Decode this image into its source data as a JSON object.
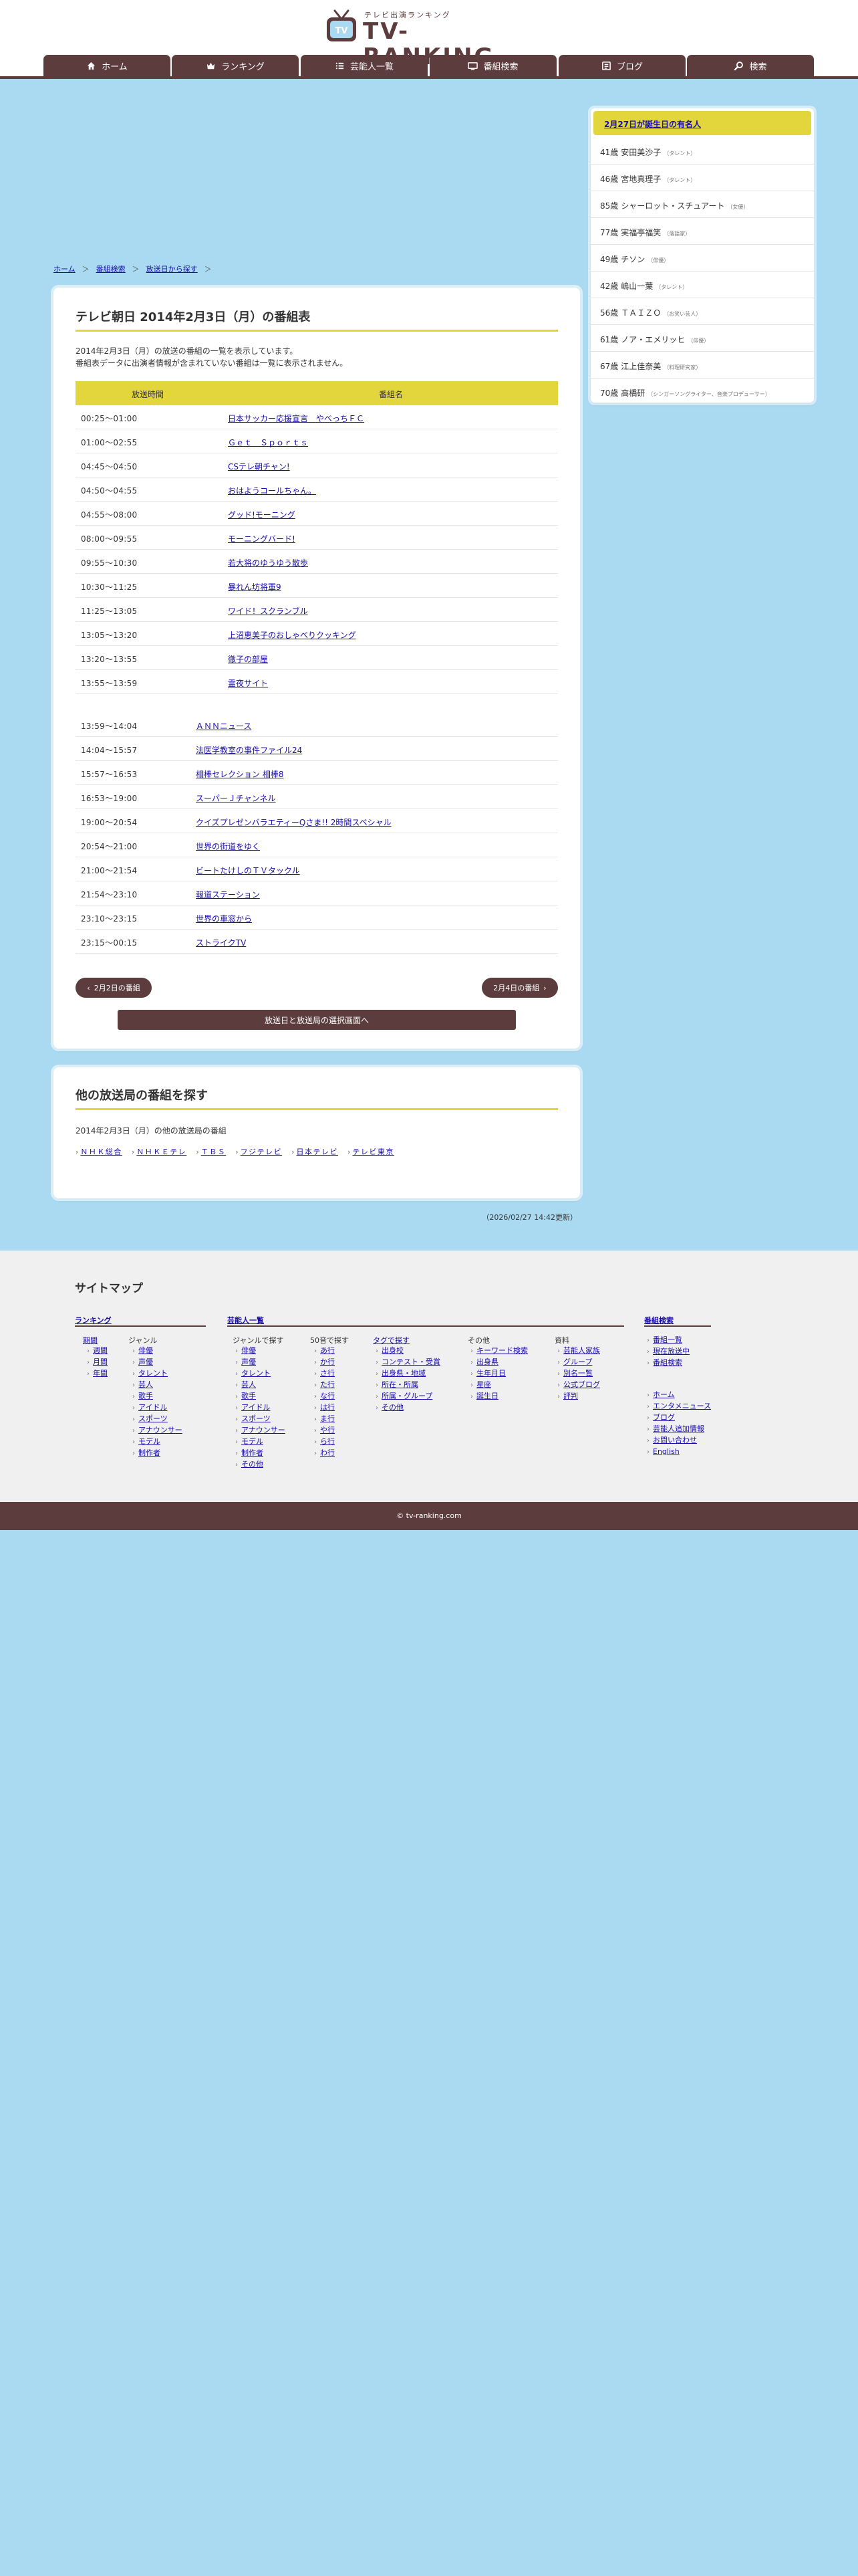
{
  "header": {
    "tagline": "テレビ出演ランキング",
    "logo_text": "TV-RANKING",
    "logo_badge": "TV",
    "nav": [
      {
        "label": "ホーム",
        "icon": "home-icon"
      },
      {
        "label": "ランキング",
        "icon": "crown-icon"
      },
      {
        "label": "芸能人一覧",
        "icon": "list-icon"
      },
      {
        "label": "番組検索",
        "icon": "tv-icon"
      },
      {
        "label": "ブログ",
        "icon": "blog-icon"
      },
      {
        "label": "検索",
        "icon": "search-icon"
      }
    ]
  },
  "breadcrumb": {
    "items": [
      "ホーム",
      "番組検索",
      "放送日から探す"
    ],
    "separator": "＞"
  },
  "schedule": {
    "title": "テレビ朝日 2014年2月3日（月）の番組表",
    "desc_line1": "2014年2月3日（月）の放送の番組の一覧を表示しています。",
    "desc_line2": "番組表データに出演者情報が含まれていない番組は一覧に表示されません。",
    "col_time": "放送時間",
    "col_program": "番組名",
    "rows": [
      {
        "time": "00:25〜01:00",
        "program": "日本サッカー応援宣言　やべっちＦＣ"
      },
      {
        "time": "01:00〜02:55",
        "program": "Ｇｅｔ　Ｓｐｏｒｔｓ"
      },
      {
        "time": "04:45〜04:50",
        "program": "CSテレ朝チャン!"
      },
      {
        "time": "04:50〜04:55",
        "program": "おはようコールちゃん。"
      },
      {
        "time": "04:55〜08:00",
        "program": "グッド!モーニング"
      },
      {
        "time": "08:00〜09:55",
        "program": "モーニングバード!"
      },
      {
        "time": "09:55〜10:30",
        "program": "若大将のゆうゆう散歩"
      },
      {
        "time": "10:30〜11:25",
        "program": "暴れん坊将軍9"
      },
      {
        "time": "11:25〜13:05",
        "program": "ワイド！スクランブル"
      },
      {
        "time": "13:05〜13:20",
        "program": "上沼恵美子のおしゃべりクッキング"
      },
      {
        "time": "13:20〜13:55",
        "program": "徹子の部屋"
      },
      {
        "time": "13:55〜13:59",
        "program": "霊夜サイト"
      }
    ],
    "rows2": [
      {
        "time": "13:59〜14:04",
        "program": "ＡＮＮニュース"
      },
      {
        "time": "14:04〜15:57",
        "program": "法医学教室の事件ファイル24"
      },
      {
        "time": "15:57〜16:53",
        "program": "相棒セレクション 相棒8"
      },
      {
        "time": "16:53〜19:00",
        "program": "スーパーＪチャンネル"
      },
      {
        "time": "19:00〜20:54",
        "program": "クイズプレゼンバラエティーQさま!! 2時間スペシャル"
      },
      {
        "time": "20:54〜21:00",
        "program": "世界の街道をゆく"
      },
      {
        "time": "21:00〜21:54",
        "program": "ビートたけしのＴＶタックル"
      },
      {
        "time": "21:54〜23:10",
        "program": "報道ステーション"
      },
      {
        "time": "23:10〜23:15",
        "program": "世界の車窓から"
      },
      {
        "time": "23:15〜00:15",
        "program": "ストライクTV"
      }
    ],
    "prev_label": "2月2日の番組",
    "next_label": "2月4日の番組",
    "select_label": "放送日と放送局の選択画面へ"
  },
  "other": {
    "title": "他の放送局の番組を探す",
    "subtitle": "2014年2月3日（月）の他の放送局の番組",
    "stations": [
      "ＮＨＫ総合",
      "ＮＨＫＥテレ",
      "ＴＢＳ",
      "フジテレビ",
      "日本テレビ",
      "テレビ東京"
    ]
  },
  "updated": "（2026/02/27 14:42更新）",
  "birthday": {
    "title": "2月27日が誕生日の有名人",
    "people": [
      {
        "age": "41歳",
        "name": "安田美沙子",
        "genre": "（タレント）"
      },
      {
        "age": "46歳",
        "name": "宮地真理子",
        "genre": "（タレント）"
      },
      {
        "age": "85歳",
        "name": "シャーロット・スチュアート",
        "genre": "（女優）"
      },
      {
        "age": "77歳",
        "name": "実福亭福笑",
        "genre": "（落語家）"
      },
      {
        "age": "49歳",
        "name": "チソン",
        "genre": "（俳優）"
      },
      {
        "age": "42歳",
        "name": "嶋山一葉",
        "genre": "（タレント）"
      },
      {
        "age": "56歳",
        "name": "ＴＡＩＺＯ",
        "genre": "（お笑い芸人）"
      },
      {
        "age": "61歳",
        "name": "ノア・エメリッヒ",
        "genre": "（俳優）"
      },
      {
        "age": "67歳",
        "name": "江上佳奈美",
        "genre": "（料理研究家）"
      },
      {
        "age": "70歳",
        "name": "高橋研",
        "genre": "（シンガーソングライター、音楽プロデューサー）"
      }
    ]
  },
  "sitemap": {
    "title": "サイトマップ",
    "ranking": {
      "head": "ランキング",
      "period_label": "期間",
      "periods": [
        "週間",
        "月間",
        "年間"
      ],
      "genre_label": "ジャンル",
      "genres": [
        "俳優",
        "声優",
        "タレント",
        "芸人",
        "歌手",
        "アイドル",
        "スポーツ",
        "アナウンサー",
        "モデル",
        "制作者"
      ]
    },
    "talents": {
      "head": "芸能人一覧",
      "genre_label": "ジャンルで探す",
      "genres": [
        "俳優",
        "声優",
        "タレント",
        "芸人",
        "歌手",
        "アイドル",
        "スポーツ",
        "アナウンサー",
        "モデル",
        "制作者",
        "その他"
      ],
      "kana_label": "50音で探す",
      "kana": [
        "あ行",
        "か行",
        "さ行",
        "た行",
        "な行",
        "は行",
        "ま行",
        "や行",
        "ら行",
        "わ行"
      ],
      "tag_label": "タグで探す",
      "tags": [
        "出身校",
        "コンテスト・受賞",
        "出身県・地域",
        "所在・所属",
        "所属・グループ",
        "その他"
      ],
      "other_label": "その他",
      "others": [
        "キーワード検索",
        "出身県",
        "生年月日",
        "星座",
        "誕生日"
      ],
      "data_label": "資料",
      "data": [
        "芸能人家族",
        "グループ",
        "別名一覧",
        "公式ブログ",
        "評判"
      ]
    },
    "program": {
      "head": "番組検索",
      "items": [
        "番組一覧",
        "現在放送中",
        "番組検索"
      ],
      "items2": [
        "ホーム",
        "エンタメニュース",
        "ブログ",
        "芸能人追加情報",
        "お問い合わせ",
        "English"
      ]
    }
  },
  "footer": {
    "copyright": "© tv-ranking.com"
  },
  "colors": {
    "accent": "#5c3c3c",
    "highlight": "#e2d63c",
    "background": "#a9daf2"
  }
}
